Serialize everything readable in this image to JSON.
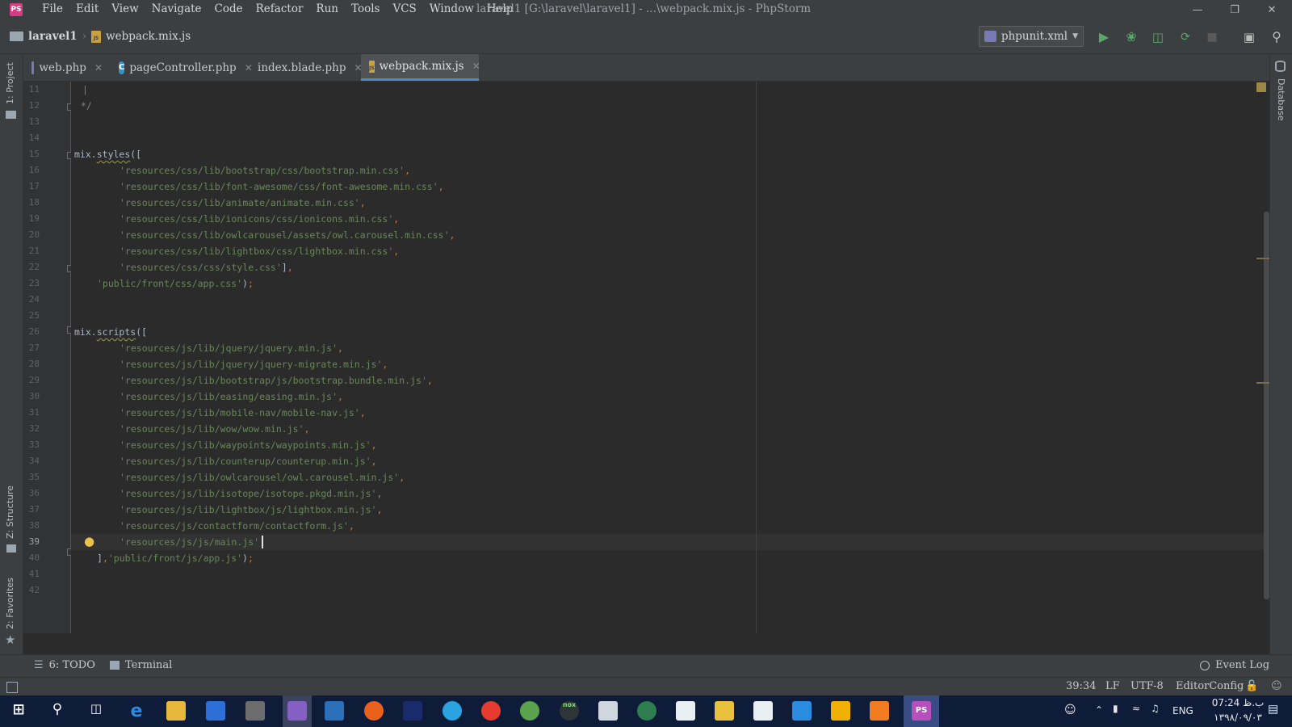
{
  "menu": [
    "File",
    "Edit",
    "View",
    "Navigate",
    "Code",
    "Refactor",
    "Run",
    "Tools",
    "VCS",
    "Window",
    "Help"
  ],
  "window_title": "laravel1 [G:\\laravel\\laravel1] - ...\\webpack.mix.js - PhpStorm",
  "app_logo": "PS",
  "breadcrumb": {
    "project": "laravel1",
    "file": "webpack.mix.js"
  },
  "run_config": "phpunit.xml",
  "left_tools": {
    "project": "1: Project",
    "structure": "Z: Structure",
    "favorites": "2: Favorites"
  },
  "right_tools": {
    "database": "Database"
  },
  "tabs": [
    {
      "label": "web.php",
      "icon": "php-file-icon",
      "active": false
    },
    {
      "label": "pageController.php",
      "icon": "php-class-icon",
      "active": false
    },
    {
      "label": "index.blade.php",
      "icon": "blade-file-icon",
      "active": false
    },
    {
      "label": "webpack.mix.js",
      "icon": "js-file-icon",
      "active": true
    }
  ],
  "line_numbers": [
    "11",
    "12",
    "13",
    "14",
    "15",
    "16",
    "17",
    "18",
    "19",
    "20",
    "21",
    "22",
    "23",
    "24",
    "25",
    "26",
    "27",
    "28",
    "29",
    "30",
    "31",
    "32",
    "33",
    "34",
    "35",
    "36",
    "37",
    "38",
    "39",
    "40",
    "41",
    "42"
  ],
  "code": {
    "l11": "|",
    "l12": "*/",
    "l15_obj": "mix",
    "l15_fn": "styles",
    "l15_rest": "([",
    "l16": "'resources/css/lib/bootstrap/css/bootstrap.min.css'",
    "l17": "'resources/css/lib/font-awesome/css/font-awesome.min.css'",
    "l18": "'resources/css/lib/animate/animate.min.css'",
    "l19": "'resources/css/lib/ionicons/css/ionicons.min.css'",
    "l20": "'resources/css/lib/owlcarousel/assets/owl.carousel.min.css'",
    "l21": "'resources/css/lib/lightbox/css/lightbox.min.css'",
    "l22": "'resources/css/css/style.css'",
    "l23": "'public/front/css/app.css'",
    "l26_obj": "mix",
    "l26_fn": "scripts",
    "l26_rest": "([",
    "l27": "'resources/js/lib/jquery/jquery.min.js'",
    "l28": "'resources/js/lib/jquery/jquery-migrate.min.js'",
    "l29": "'resources/js/lib/bootstrap/js/bootstrap.bundle.min.js'",
    "l30": "'resources/js/lib/easing/easing.min.js'",
    "l31": "'resources/js/lib/mobile-nav/mobile-nav.js'",
    "l32": "'resources/js/lib/wow/wow.min.js'",
    "l33": "'resources/js/lib/waypoints/waypoints.min.js'",
    "l34": "'resources/js/lib/counterup/counterup.min.js'",
    "l35": "'resources/js/lib/owlcarousel/owl.carousel.min.js'",
    "l36": "'resources/js/lib/isotope/isotope.pkgd.min.js'",
    "l37": "'resources/js/lib/lightbox/js/lightbox.min.js'",
    "l38": "'resources/js/contactform/contactform.js'",
    "l39": "'resources/js/js/main.js'",
    "l40_str": "'public/front/js/app.js'"
  },
  "bottom_tools": {
    "todo": "6: TODO",
    "terminal": "Terminal",
    "event_log": "Event Log"
  },
  "status": {
    "position": "39:34",
    "line_sep": "LF",
    "encoding": "UTF-8",
    "editorconfig": "EditorConfig"
  },
  "tray": {
    "lang": "ENG",
    "time": "07:24 ب.ظ",
    "date": "۱۳۹۸/۰۹/۰۳"
  },
  "colors": {
    "accent": "#4a88c7",
    "string": "#6a8759",
    "keyword": "#cc7832",
    "run": "#59a869"
  }
}
